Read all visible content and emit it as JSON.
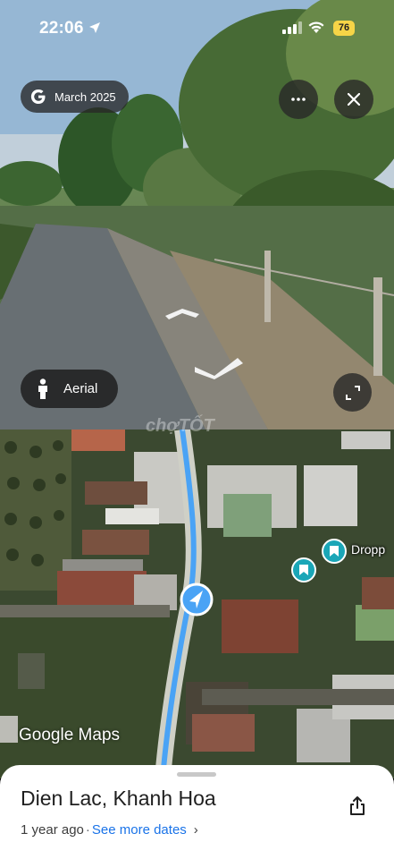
{
  "status_bar": {
    "time": "22:06",
    "battery": "76"
  },
  "street_view": {
    "capture_date": "March 2025",
    "aerial_label": "Aerial",
    "watermark": "chợTỐT"
  },
  "map": {
    "pin_label": "Dropp",
    "attribution": "Google Maps"
  },
  "place": {
    "title": "Dien Lac, Khanh Hoa",
    "age": "1 year ago",
    "separator": "·",
    "see_more": "See more dates"
  },
  "colors": {
    "link": "#1a73e8",
    "route": "#4aa3f5",
    "battery": "#f6d547",
    "pin": "#1aa6b7"
  }
}
